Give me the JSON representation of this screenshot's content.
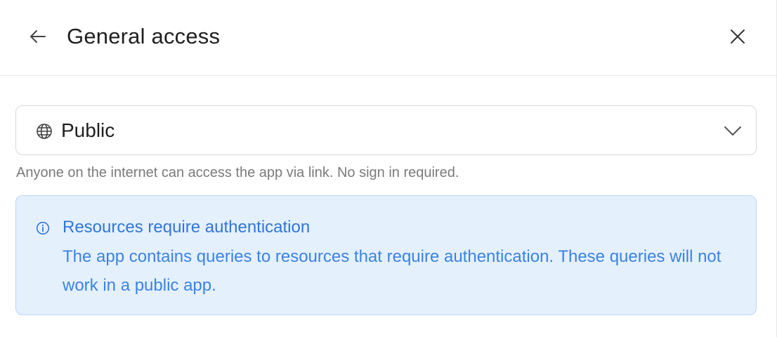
{
  "header": {
    "title": "General access",
    "back_icon": "arrow-left-icon",
    "close_icon": "close-icon"
  },
  "access_select": {
    "icon": "globe-icon",
    "value": "Public",
    "dropdown_icon": "chevron-down-icon"
  },
  "helper_text": "Anyone on the internet can access the app via link. No sign in required.",
  "alert": {
    "icon": "info-icon",
    "title": "Resources require authentication",
    "body": "The app contains queries to resources that require authentication. These queries will not work in a public app.",
    "colors": {
      "background": "#e5f0fd",
      "border": "#b9d6f5",
      "text": "#2f76d9"
    }
  }
}
